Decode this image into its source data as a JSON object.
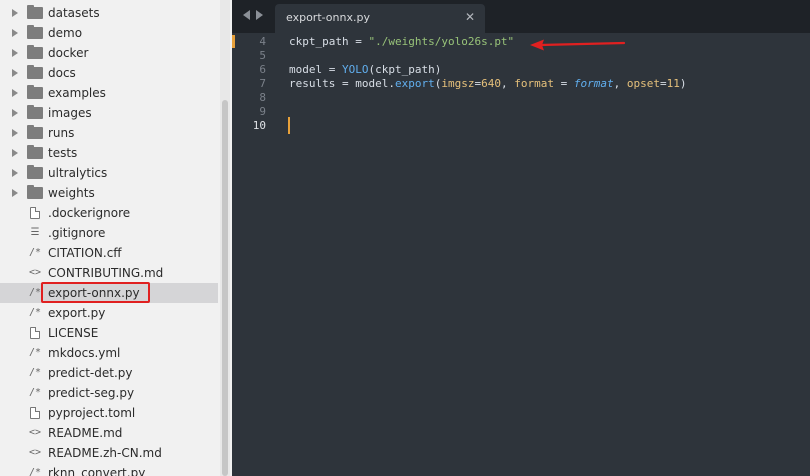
{
  "sidebar": {
    "items": [
      {
        "label": "datasets",
        "type": "folder"
      },
      {
        "label": "demo",
        "type": "folder"
      },
      {
        "label": "docker",
        "type": "folder"
      },
      {
        "label": "docs",
        "type": "folder"
      },
      {
        "label": "examples",
        "type": "folder"
      },
      {
        "label": "images",
        "type": "folder"
      },
      {
        "label": "runs",
        "type": "folder"
      },
      {
        "label": "tests",
        "type": "folder"
      },
      {
        "label": "ultralytics",
        "type": "folder"
      },
      {
        "label": "weights",
        "type": "folder"
      },
      {
        "label": ".dockerignore",
        "type": "file-plain"
      },
      {
        "label": ".gitignore",
        "type": "file-list"
      },
      {
        "label": "CITATION.cff",
        "type": "file-comment"
      },
      {
        "label": "CONTRIBUTING.md",
        "type": "file-markup"
      },
      {
        "label": "export-onnx.py",
        "type": "file-comment",
        "selected": true
      },
      {
        "label": "export.py",
        "type": "file-comment"
      },
      {
        "label": "LICENSE",
        "type": "file-plain"
      },
      {
        "label": "mkdocs.yml",
        "type": "file-comment"
      },
      {
        "label": "predict-det.py",
        "type": "file-comment"
      },
      {
        "label": "predict-seg.py",
        "type": "file-comment"
      },
      {
        "label": "pyproject.toml",
        "type": "file-plain"
      },
      {
        "label": "README.md",
        "type": "file-markup"
      },
      {
        "label": "README.zh-CN.md",
        "type": "file-markup"
      },
      {
        "label": "rknn_convert.py",
        "type": "file-comment"
      }
    ]
  },
  "tab": {
    "title": "export-onnx.py",
    "close_glyph": "✕"
  },
  "icons": {
    "comment": "/*",
    "markup": "<>",
    "list": "☰"
  },
  "editor": {
    "line_numbers": [
      "4",
      "5",
      "6",
      "7",
      "8",
      "9",
      "10"
    ],
    "active_line": "10",
    "lines": {
      "l4": {
        "var": "ckpt_path",
        "eq": " = ",
        "str": "\"./weights/yolo26s.pt\""
      },
      "l6": {
        "a": "model = ",
        "fn": "YOLO",
        "b": "(ckpt_path)"
      },
      "l7": {
        "a": "results = model.",
        "fn": "export",
        "b": "(",
        "k1": "imgsz",
        "e1": "=",
        "n1": "640",
        "c1": ", ",
        "k2": "format",
        "e2": " = ",
        "v2": "format",
        "c2": ", ",
        "k3": "opset",
        "e3": "=",
        "n3": "11",
        "end": ")"
      }
    }
  },
  "colors": {
    "annotation": "#e02020",
    "cursor": "#e8a13a"
  }
}
